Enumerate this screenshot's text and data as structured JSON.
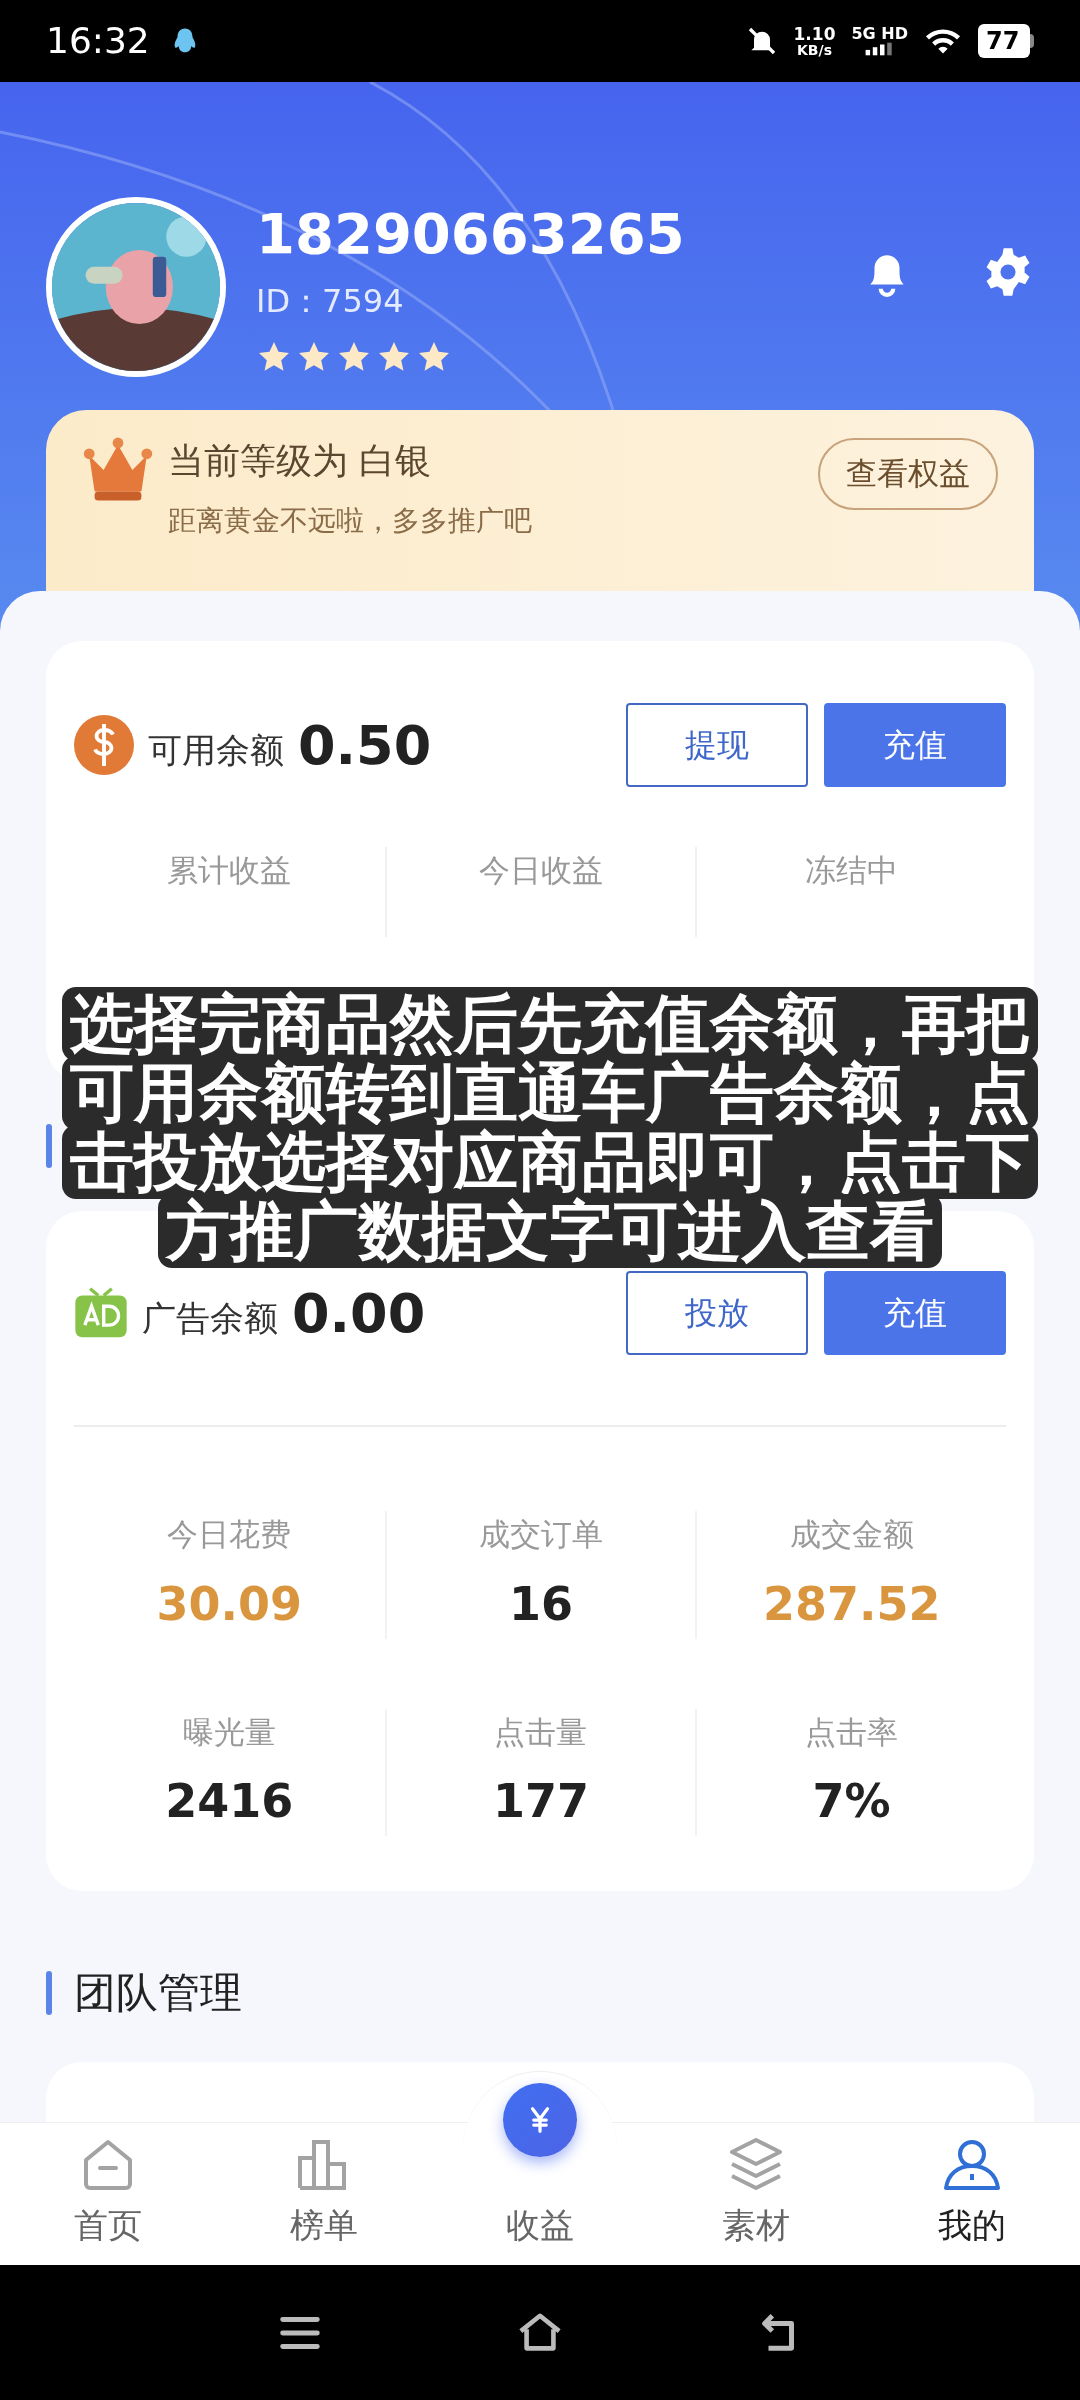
{
  "status_bar": {
    "time": "16:32",
    "speed_value": "1.10",
    "speed_unit": "KB/s",
    "network": "5G HD",
    "battery": "77"
  },
  "profile": {
    "phone": "18290663265",
    "id": "ID：7594",
    "stars": 5
  },
  "level_card": {
    "title": "当前等级为 白银",
    "subtitle": "距离黄金不远啦，多多推广吧",
    "button": "查看权益"
  },
  "balance_card": {
    "label": "可用余额",
    "amount": "0.50",
    "buttons": [
      {
        "label": "提现",
        "kind": "outline"
      },
      {
        "label": "充值",
        "kind": "filled"
      }
    ],
    "stats": [
      {
        "label": "累计收益"
      },
      {
        "label": "今日收益"
      },
      {
        "label": "冻结中"
      }
    ]
  },
  "caption": "选择完商品然后先充值余额，再把可用余额转到直通车广告余额，点击投放选择对应商品即可，点击下方推广数据文字可进入查看",
  "ad_card": {
    "label": "广告余额",
    "amount": "0.00",
    "buttons": [
      {
        "label": "投放",
        "kind": "outline"
      },
      {
        "label": "充值",
        "kind": "filled"
      }
    ],
    "stats": [
      {
        "label": "今日花费",
        "value": "30.09",
        "highlight": true
      },
      {
        "label": "成交订单",
        "value": "16",
        "highlight": false
      },
      {
        "label": "成交金额",
        "value": "287.52",
        "highlight": true
      },
      {
        "label": "曝光量",
        "value": "2416",
        "highlight": false
      },
      {
        "label": "点击量",
        "value": "177",
        "highlight": false
      },
      {
        "label": "点击率",
        "value": "7%",
        "highlight": false
      }
    ]
  },
  "team_section": {
    "title": "团队管理"
  },
  "bottom_nav": [
    {
      "label": "首页",
      "selected": false,
      "kind": "home"
    },
    {
      "label": "榜单",
      "selected": false,
      "kind": "chart"
    },
    {
      "label": "收益",
      "selected": false,
      "kind": "center"
    },
    {
      "label": "素材",
      "selected": false,
      "kind": "layers"
    },
    {
      "label": "我的",
      "selected": true,
      "kind": "user"
    }
  ]
}
